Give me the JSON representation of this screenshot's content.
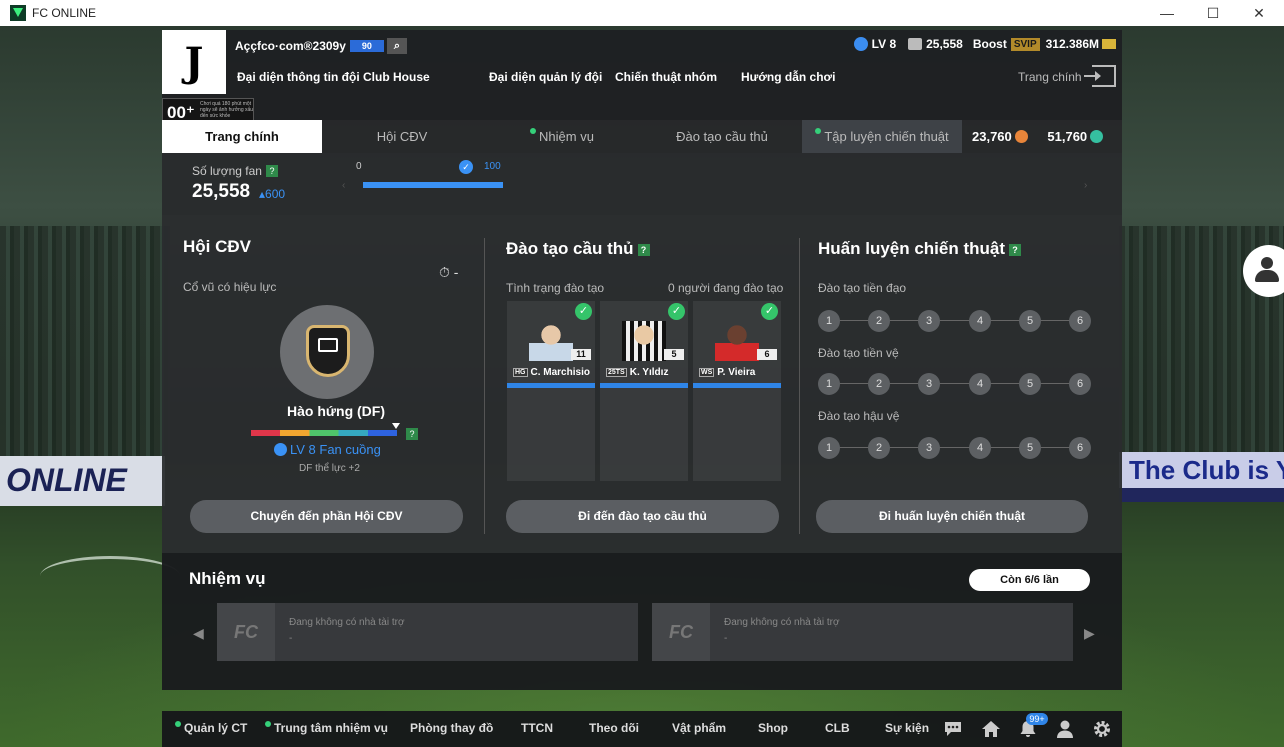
{
  "window": {
    "title": "FC ONLINE",
    "minimize": "—",
    "maximize": "☐",
    "close": "✕"
  },
  "header": {
    "club_initial": "J",
    "account": "Aççfco·com®2309y",
    "level_tag": "90",
    "search_icon": "⌕",
    "ovr_value": "00⁺",
    "ovr_note": "Chơi quá 180 phút một ngày sẽ ảnh hưởng xấu đến sức khỏe",
    "level": "LV 8",
    "fans": "25,558",
    "boost_label": "Boost",
    "svip": "SVIP",
    "bp": "312.386M",
    "nav": [
      "Đại diện thông tin đội",
      "Club House",
      "Đại diện quản lý đội",
      "Chiến thuật nhóm",
      "Hướng dẫn chơi"
    ],
    "home_link": "Trang chính"
  },
  "tabs": {
    "items": [
      "Trang chính",
      "Hội CĐV",
      "Nhiệm vụ",
      "Đào tạo cầu thủ",
      "Tập luyện chiến thuật"
    ],
    "currency1": "23,760",
    "currency2": "51,760"
  },
  "fan_count": {
    "label": "Số lượng fan",
    "qmark": "?",
    "value": "25,558",
    "delta": "▴600",
    "progress_start": "0",
    "progress_end": "100",
    "progress_fraction": 1.0,
    "check": "✓"
  },
  "supporters": {
    "title": "Hội CĐV",
    "effect_label": "Cổ vũ có hiệu lực",
    "timer": "⏱ -",
    "chant": "Hào hứng (DF)",
    "fan_level": "LV 8 Fan cuồng",
    "qmark": "?",
    "bonus": "DF thể lực +2",
    "button": "Chuyển đến phần Hội CĐV"
  },
  "training": {
    "title": "Đào tạo cầu thủ",
    "qmark": "?",
    "status_label": "Tình trạng đào tạo",
    "count_label": "0 người đang đào tạo",
    "players": [
      {
        "tag": "HG",
        "name": "C. Marchisio",
        "number": "11",
        "check": "✓"
      },
      {
        "tag": "25TS",
        "name": "K. Yıldız",
        "number": "5",
        "check": "✓"
      },
      {
        "tag": "WS",
        "name": "P. Vieira",
        "number": "6",
        "check": "✓"
      }
    ],
    "button": "Đi đến đào tạo cầu thủ"
  },
  "tactics": {
    "title": "Huấn luyện chiến thuật",
    "qmark": "?",
    "rows": [
      "Đào tạo tiền đạo",
      "Đào tạo tiền vệ",
      "Đào tạo hậu vệ"
    ],
    "steps": [
      "1",
      "2",
      "3",
      "4",
      "5",
      "6"
    ],
    "button": "Đi huấn luyện chiến thuật"
  },
  "missions": {
    "title": "Nhiệm vụ",
    "remaining": "Còn 6/6 lần",
    "cards": [
      {
        "logo": "FC",
        "text": "Đang không có nhà tài trợ",
        "sub": "-"
      },
      {
        "logo": "FC",
        "text": "Đang không có nhà tài trợ",
        "sub": "-"
      }
    ],
    "prev": "◀",
    "next": "▶"
  },
  "bottom_nav": {
    "items": [
      "Quản lý CT",
      "Trung tâm nhiệm vụ",
      "Phòng thay đồ",
      "TTCN",
      "Theo dõi",
      "Vật phẩm",
      "Shop",
      "CLB",
      "Sự kiện"
    ],
    "notif_count": "99+"
  },
  "background": {
    "board_left": "ONLINE",
    "board_right": "The Club is Y"
  },
  "colors": {
    "accent_blue": "#2f85e8",
    "success_green": "#35c46a",
    "gold": "#d8b43a"
  }
}
